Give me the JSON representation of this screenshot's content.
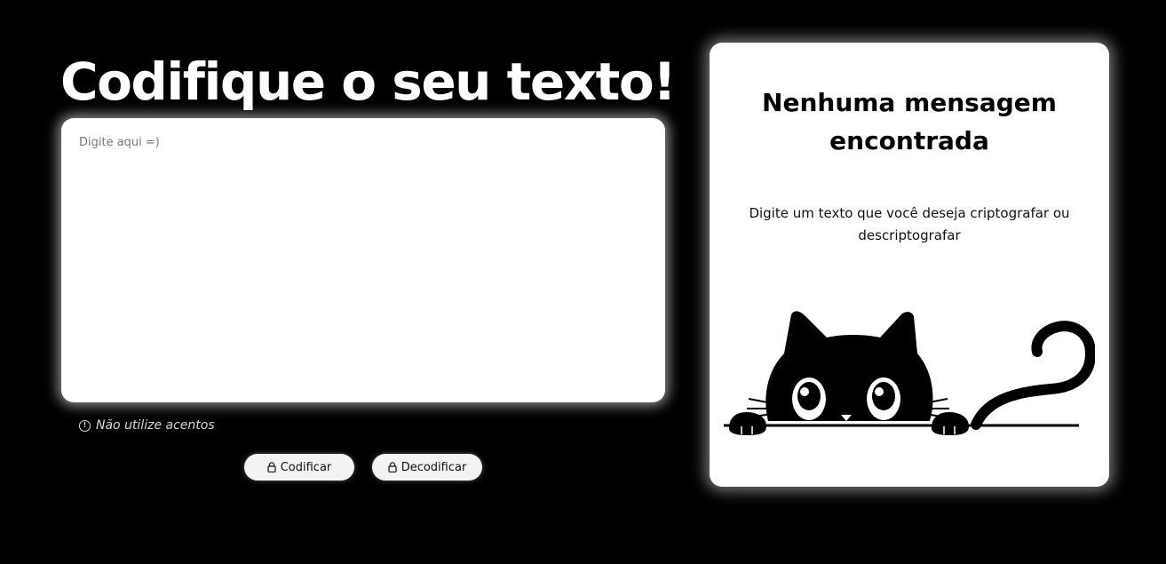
{
  "header": {
    "title": "Codifique o seu texto!"
  },
  "input": {
    "placeholder": "Digite aqui =)",
    "value": ""
  },
  "hint": {
    "icon": "info-circle-icon",
    "text": "Não utilize acentos"
  },
  "buttons": {
    "encode_label": "Codificar",
    "decode_label": "Decodificar",
    "icon": "lock-icon"
  },
  "output_panel": {
    "title": "Nenhuma mensagem encontrada",
    "description": "Digite um texto que você deseja criptografar ou descriptografar",
    "illustration": "peeking-cat-illustration"
  },
  "colors": {
    "background": "#000000",
    "card": "#ffffff",
    "button": "#f3f3f3",
    "text_dark": "#000000",
    "text_light": "#ffffff"
  }
}
